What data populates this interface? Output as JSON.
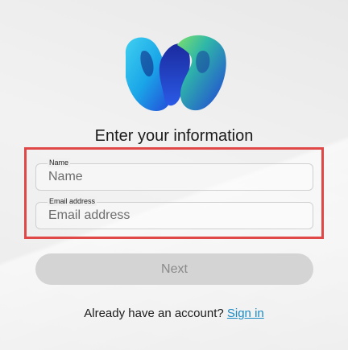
{
  "brand": {
    "logo_icon": "webex-logo-icon",
    "colors": [
      "#35c0e8",
      "#2a64e6",
      "#67d653",
      "#1c2bb8"
    ]
  },
  "form": {
    "title": "Enter your information",
    "name_field": {
      "label": "Name",
      "placeholder": "Name",
      "value": ""
    },
    "email_field": {
      "label": "Email address",
      "placeholder": "Email address",
      "value": ""
    },
    "next_label": "Next",
    "next_enabled": false
  },
  "footer": {
    "prompt": "Already have an account?",
    "signin_label": "Sign in"
  },
  "highlight_color": "#e04747"
}
